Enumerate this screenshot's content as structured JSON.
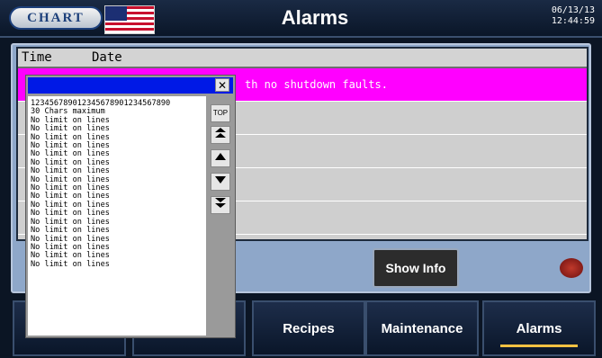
{
  "header": {
    "logo_text": "CHART",
    "title": "Alarms",
    "date": "06/13/13",
    "time": "12:44:59"
  },
  "table": {
    "columns": [
      "Time",
      "Date"
    ],
    "rows": [
      "th no shutdown faults.",
      "",
      "",
      "",
      ""
    ]
  },
  "buttons": {
    "show_info": "Show Info"
  },
  "nav": [
    {
      "label": ""
    },
    {
      "label": ""
    },
    {
      "label": "Recipes"
    },
    {
      "label": "Maintenance"
    },
    {
      "label": "Alarms"
    }
  ],
  "popup": {
    "close_label": "✕",
    "top_label": "TOP",
    "lines": [
      "123456789012345678901234567890",
      "30 Chars maximum",
      "No limit on lines",
      "No limit on lines",
      "No limit on lines",
      "No limit on lines",
      "No limit on lines",
      "No limit on lines",
      "No limit on lines",
      "No limit on lines",
      "No limit on lines",
      "No limit on lines",
      "No limit on lines",
      "No limit on lines",
      "No limit on lines",
      "No limit on lines",
      "No limit on lines",
      "No limit on lines",
      "No limit on lines",
      "No limit on lines"
    ],
    "icons": [
      "first-page-up-icon",
      "up-arrow-icon",
      "down-arrow-icon",
      "last-page-down-icon"
    ]
  },
  "colors": {
    "alarm_row": "#ff00ff",
    "popup_title": "#0019e6",
    "active_tab_underline": "#f5c242"
  }
}
